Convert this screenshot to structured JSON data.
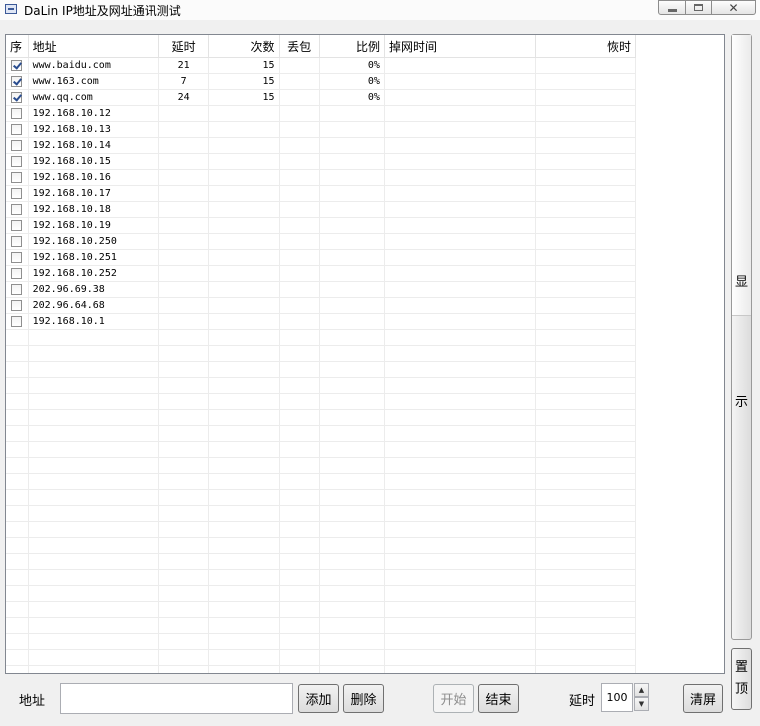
{
  "window": {
    "title": "DaLin IP地址及网址通讯测试",
    "controls": {
      "minimize": "minimize-icon",
      "maximize": "maximize-icon",
      "close": "✕"
    }
  },
  "grid": {
    "columns": [
      "序",
      "地址",
      "延时",
      "次数",
      "丢包",
      "比例",
      "掉网时间",
      "恢时"
    ],
    "rows": [
      {
        "checked": true,
        "address": "www.baidu.com",
        "delay": "21",
        "count": "15",
        "loss": "",
        "ratio": "0%",
        "down_time": "",
        "recover_time": ""
      },
      {
        "checked": true,
        "address": "www.163.com",
        "delay": "7",
        "count": "15",
        "loss": "",
        "ratio": "0%",
        "down_time": "",
        "recover_time": ""
      },
      {
        "checked": true,
        "address": "www.qq.com",
        "delay": "24",
        "count": "15",
        "loss": "",
        "ratio": "0%",
        "down_time": "",
        "recover_time": ""
      },
      {
        "checked": false,
        "address": "192.168.10.12",
        "delay": "",
        "count": "",
        "loss": "",
        "ratio": "",
        "down_time": "",
        "recover_time": ""
      },
      {
        "checked": false,
        "address": "192.168.10.13",
        "delay": "",
        "count": "",
        "loss": "",
        "ratio": "",
        "down_time": "",
        "recover_time": ""
      },
      {
        "checked": false,
        "address": "192.168.10.14",
        "delay": "",
        "count": "",
        "loss": "",
        "ratio": "",
        "down_time": "",
        "recover_time": ""
      },
      {
        "checked": false,
        "address": "192.168.10.15",
        "delay": "",
        "count": "",
        "loss": "",
        "ratio": "",
        "down_time": "",
        "recover_time": ""
      },
      {
        "checked": false,
        "address": "192.168.10.16",
        "delay": "",
        "count": "",
        "loss": "",
        "ratio": "",
        "down_time": "",
        "recover_time": ""
      },
      {
        "checked": false,
        "address": "192.168.10.17",
        "delay": "",
        "count": "",
        "loss": "",
        "ratio": "",
        "down_time": "",
        "recover_time": ""
      },
      {
        "checked": false,
        "address": "192.168.10.18",
        "delay": "",
        "count": "",
        "loss": "",
        "ratio": "",
        "down_time": "",
        "recover_time": ""
      },
      {
        "checked": false,
        "address": "192.168.10.19",
        "delay": "",
        "count": "",
        "loss": "",
        "ratio": "",
        "down_time": "",
        "recover_time": ""
      },
      {
        "checked": false,
        "address": "192.168.10.250",
        "delay": "",
        "count": "",
        "loss": "",
        "ratio": "",
        "down_time": "",
        "recover_time": ""
      },
      {
        "checked": false,
        "address": "192.168.10.251",
        "delay": "",
        "count": "",
        "loss": "",
        "ratio": "",
        "down_time": "",
        "recover_time": ""
      },
      {
        "checked": false,
        "address": "192.168.10.252",
        "delay": "",
        "count": "",
        "loss": "",
        "ratio": "",
        "down_time": "",
        "recover_time": ""
      },
      {
        "checked": false,
        "address": "202.96.69.38",
        "delay": "",
        "count": "",
        "loss": "",
        "ratio": "",
        "down_time": "",
        "recover_time": ""
      },
      {
        "checked": false,
        "address": "202.96.64.68",
        "delay": "",
        "count": "",
        "loss": "",
        "ratio": "",
        "down_time": "",
        "recover_time": ""
      },
      {
        "checked": false,
        "address": "192.168.10.1",
        "delay": "",
        "count": "",
        "loss": "",
        "ratio": "",
        "down_time": "",
        "recover_time": ""
      }
    ]
  },
  "side": {
    "show_top": "显",
    "show_bottom": "示",
    "pin_top": "置",
    "pin_bottom": "顶"
  },
  "bottom": {
    "address_label": "地址",
    "address_value": "",
    "add_button": "添加",
    "delete_button": "删除",
    "start_button": "开始",
    "end_button": "结束",
    "delay_label": "延时",
    "delay_value": "100",
    "clear_button": "清屏",
    "spin_up": "▲",
    "spin_down": "▼"
  }
}
